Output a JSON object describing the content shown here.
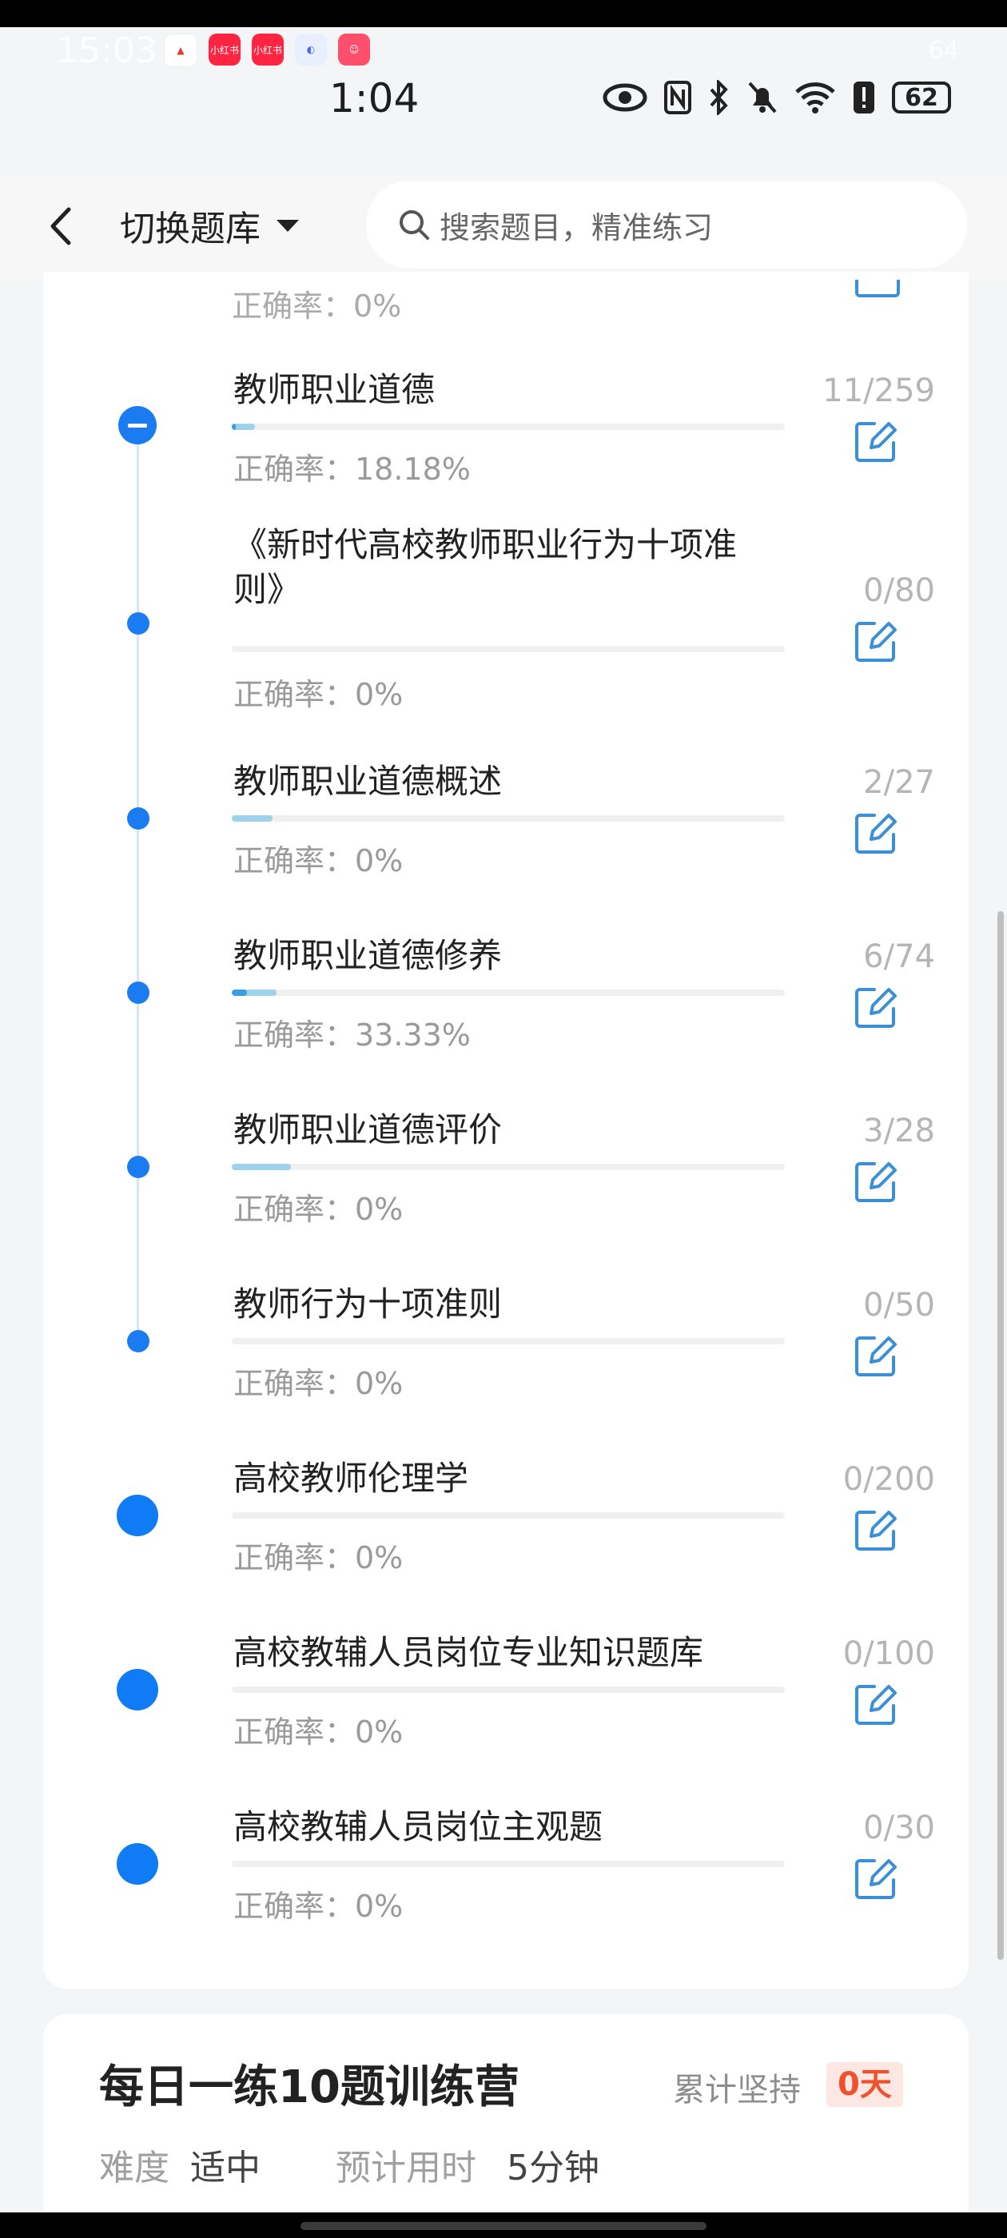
{
  "ghost_status": {
    "time": "15:03",
    "level": "64",
    "apps": [
      "",
      "小红书",
      "小红书",
      "",
      ""
    ]
  },
  "status": {
    "time": "1:04",
    "battery": "62"
  },
  "nav": {
    "switch_label": "切换题库",
    "search_placeholder": "搜索题目，精准练习"
  },
  "partial_row": {
    "accuracy_label": "正确率：0%"
  },
  "items": [
    {
      "title": "教师职业道德",
      "progress": "11/259",
      "accuracy_label": "正确率：18.18%",
      "done_fraction": 0.0425,
      "correct_fraction": 0.0077,
      "marker": "collapse"
    },
    {
      "title": "《新时代高校教师职业行为十项准\n则》",
      "progress": "0/80",
      "accuracy_label": "正确率：0%",
      "done_fraction": 0,
      "correct_fraction": 0,
      "marker": "small"
    },
    {
      "title": "教师职业道德概述",
      "progress": "2/27",
      "accuracy_label": "正确率：0%",
      "done_fraction": 0.074,
      "correct_fraction": 0,
      "marker": "small"
    },
    {
      "title": "教师职业道德修养",
      "progress": "6/74",
      "accuracy_label": "正确率：33.33%",
      "done_fraction": 0.081,
      "correct_fraction": 0.027,
      "marker": "small"
    },
    {
      "title": "教师职业道德评价",
      "progress": "3/28",
      "accuracy_label": "正确率：0%",
      "done_fraction": 0.107,
      "correct_fraction": 0,
      "marker": "small"
    },
    {
      "title": "教师行为十项准则",
      "progress": "0/50",
      "accuracy_label": "正确率：0%",
      "done_fraction": 0,
      "correct_fraction": 0,
      "marker": "small"
    },
    {
      "title": "高校教师伦理学",
      "progress": "0/200",
      "accuracy_label": "正确率：0%",
      "done_fraction": 0,
      "correct_fraction": 0,
      "marker": "big"
    },
    {
      "title": "高校教辅人员岗位专业知识题库",
      "progress": "0/100",
      "accuracy_label": "正确率：0%",
      "done_fraction": 0,
      "correct_fraction": 0,
      "marker": "big"
    },
    {
      "title": "高校教辅人员岗位主观题",
      "progress": "0/30",
      "accuracy_label": "正确率：0%",
      "done_fraction": 0,
      "correct_fraction": 0,
      "marker": "big"
    }
  ],
  "daily": {
    "title": "每日一练10题训练营",
    "persist_label": "累计坚持",
    "persist_value": "0天",
    "difficulty_label": "难度",
    "difficulty_value": "适中",
    "time_label": "预计用时",
    "time_value": "5分钟"
  },
  "colors": {
    "accent": "#1a7cf0",
    "edit_icon": "#3a8fd6",
    "badge_text": "#f0512c",
    "badge_bg": "#fde7e2"
  }
}
